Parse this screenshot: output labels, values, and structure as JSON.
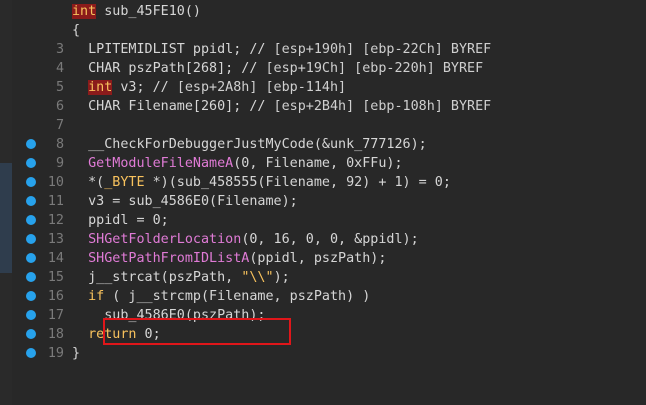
{
  "lines": [
    {
      "num": "",
      "breakpoint": false,
      "tokens": [
        {
          "t": "kwbox",
          "s": "int"
        },
        {
          "t": "plain",
          "s": " sub_45FE10()"
        }
      ]
    },
    {
      "num": "",
      "breakpoint": false,
      "tokens": [
        {
          "t": "plain",
          "s": "{"
        }
      ]
    },
    {
      "num": "3",
      "breakpoint": false,
      "tokens": [
        {
          "t": "plain",
          "s": "  LPITEMIDLIST ppidl; // "
        },
        {
          "t": "cm",
          "s": "[esp+190h] [ebp-22Ch] BYREF"
        }
      ]
    },
    {
      "num": "4",
      "breakpoint": false,
      "tokens": [
        {
          "t": "plain",
          "s": "  CHAR pszPath[268]; // "
        },
        {
          "t": "cm",
          "s": "[esp+19Ch] [ebp-220h] BYREF"
        }
      ]
    },
    {
      "num": "5",
      "breakpoint": false,
      "tokens": [
        {
          "t": "plain",
          "s": "  "
        },
        {
          "t": "kwbox",
          "s": "int"
        },
        {
          "t": "plain",
          "s": " v3; // "
        },
        {
          "t": "cm",
          "s": "[esp+2A8h] [ebp-114h]"
        }
      ]
    },
    {
      "num": "6",
      "breakpoint": false,
      "tokens": [
        {
          "t": "plain",
          "s": "  CHAR Filename[260]; // "
        },
        {
          "t": "cm",
          "s": "[esp+2B4h] [ebp-108h] BYREF"
        }
      ]
    },
    {
      "num": "7",
      "breakpoint": false,
      "tokens": []
    },
    {
      "num": "8",
      "breakpoint": true,
      "tokens": [
        {
          "t": "plain",
          "s": "  __CheckForDebuggerJustMyCode(&unk_777126);"
        }
      ]
    },
    {
      "num": "9",
      "breakpoint": true,
      "tokens": [
        {
          "t": "plain",
          "s": "  "
        },
        {
          "t": "fn",
          "s": "GetModuleFileNameA"
        },
        {
          "t": "plain",
          "s": "(0, Filename, 0xFFu);"
        }
      ]
    },
    {
      "num": "10",
      "breakpoint": true,
      "tokens": [
        {
          "t": "plain",
          "s": "  *("
        },
        {
          "t": "kw",
          "s": "_BYTE"
        },
        {
          "t": "plain",
          "s": " *)(sub_458555(Filename, 92) + 1) = 0;"
        }
      ]
    },
    {
      "num": "11",
      "breakpoint": true,
      "tokens": [
        {
          "t": "plain",
          "s": "  v3 = sub_4586E0(Filename);"
        }
      ]
    },
    {
      "num": "12",
      "breakpoint": true,
      "tokens": [
        {
          "t": "plain",
          "s": "  ppidl = 0;"
        }
      ]
    },
    {
      "num": "13",
      "breakpoint": true,
      "tokens": [
        {
          "t": "plain",
          "s": "  "
        },
        {
          "t": "fn",
          "s": "SHGetFolderLocation"
        },
        {
          "t": "plain",
          "s": "(0, 16, 0, 0, &ppidl);"
        }
      ]
    },
    {
      "num": "14",
      "breakpoint": true,
      "tokens": [
        {
          "t": "plain",
          "s": "  "
        },
        {
          "t": "fn",
          "s": "SHGetPathFromIDListA"
        },
        {
          "t": "plain",
          "s": "(ppidl, pszPath);"
        }
      ]
    },
    {
      "num": "15",
      "breakpoint": true,
      "tokens": [
        {
          "t": "plain",
          "s": "  j__strcat(pszPath, "
        },
        {
          "t": "str",
          "s": "\"\\\\\""
        },
        {
          "t": "plain",
          "s": ");"
        }
      ]
    },
    {
      "num": "16",
      "breakpoint": true,
      "tokens": [
        {
          "t": "plain",
          "s": "  "
        },
        {
          "t": "kw",
          "s": "if"
        },
        {
          "t": "plain",
          "s": " ( j__strcmp(Filename, pszPath) )"
        }
      ]
    },
    {
      "num": "17",
      "breakpoint": true,
      "tokens": [
        {
          "t": "plain",
          "s": "    sub_4586E0(pszPath);"
        }
      ]
    },
    {
      "num": "18",
      "breakpoint": true,
      "tokens": [
        {
          "t": "plain",
          "s": "  "
        },
        {
          "t": "kw",
          "s": "return"
        },
        {
          "t": "plain",
          "s": " 0;"
        }
      ]
    },
    {
      "num": "19",
      "breakpoint": true,
      "tokens": [
        {
          "t": "plain",
          "s": "}"
        }
      ]
    }
  ]
}
